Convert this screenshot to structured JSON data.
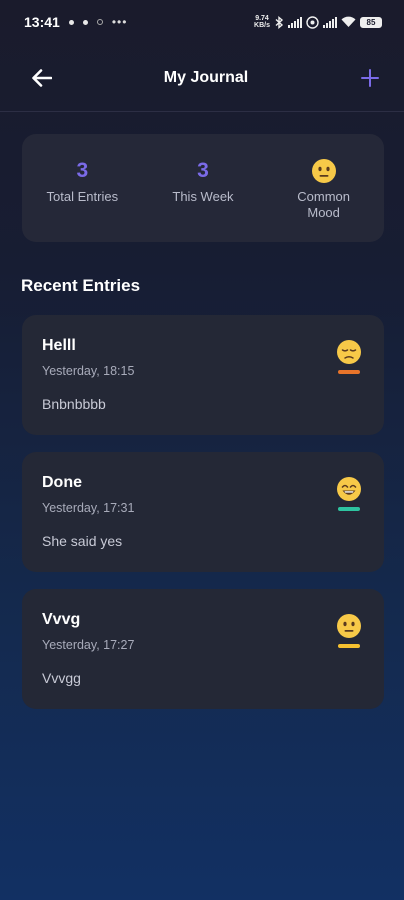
{
  "status_bar": {
    "time": "13:41",
    "speed_value": "9.74",
    "speed_unit": "KB/s",
    "battery": "85"
  },
  "header": {
    "title": "My Journal",
    "back_icon": "arrow-left-icon",
    "add_icon": "plus-icon",
    "accent_color": "#7b6be8"
  },
  "stats": {
    "total_entries_value": "3",
    "total_entries_label": "Total Entries",
    "this_week_value": "3",
    "this_week_label": "This Week",
    "common_mood_icon": "neutral-face-icon",
    "common_mood_label": "Common Mood"
  },
  "recent": {
    "section_title": "Recent Entries",
    "entries": [
      {
        "title": "Helll",
        "date": "Yesterday, 18:15",
        "body": "Bnbnbbbb",
        "mood_icon": "sad-face-icon",
        "mood_color": "#e8742a"
      },
      {
        "title": "Done",
        "date": "Yesterday, 17:31",
        "body": "She said yes",
        "mood_icon": "grinning-face-icon",
        "mood_color": "#2ec4a0"
      },
      {
        "title": "Vvvg",
        "date": "Yesterday, 17:27",
        "body": "Vvvgg",
        "mood_icon": "neutral-face-icon",
        "mood_color": "#f5c030"
      }
    ]
  }
}
